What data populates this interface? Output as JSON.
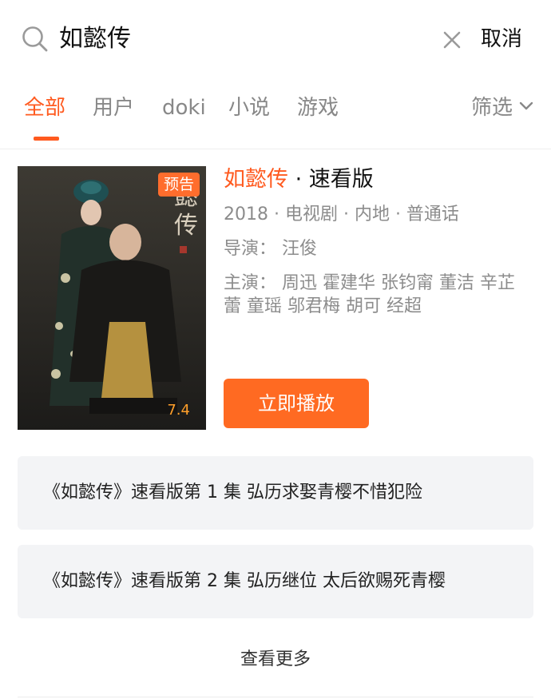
{
  "search": {
    "query": "如懿传",
    "cancel_label": "取消"
  },
  "tabs": [
    {
      "label": "全部",
      "active": true
    },
    {
      "label": "用户",
      "active": false
    },
    {
      "label": "doki",
      "active": false
    },
    {
      "label": "小说",
      "active": false
    },
    {
      "label": "游戏",
      "active": false
    }
  ],
  "filter": {
    "label": "筛选"
  },
  "result": {
    "title": "如懿传",
    "title_suffix": " · 速看版",
    "badge": "预告",
    "score": "7.4",
    "meta": "2018 · 电视剧 · 内地 · 普通话",
    "director": "导演：  汪俊",
    "cast": "主演：  周迅 霍建华 张钧甯 董洁 辛芷蕾 童瑶 邬君梅 胡可 经超",
    "play_label": "立即播放"
  },
  "episodes": [
    {
      "label": "《如懿传》速看版第 1 集 弘历求娶青樱不惜犯险"
    },
    {
      "label": "《如懿传》速看版第 2 集 弘历继位 太后欲赐死青樱"
    }
  ],
  "more_label": "查看更多",
  "colors": {
    "accent": "#ff5a1f",
    "play_button": "#ff6a22",
    "badge": "#ff6d2d",
    "score": "#ff9f2a"
  }
}
